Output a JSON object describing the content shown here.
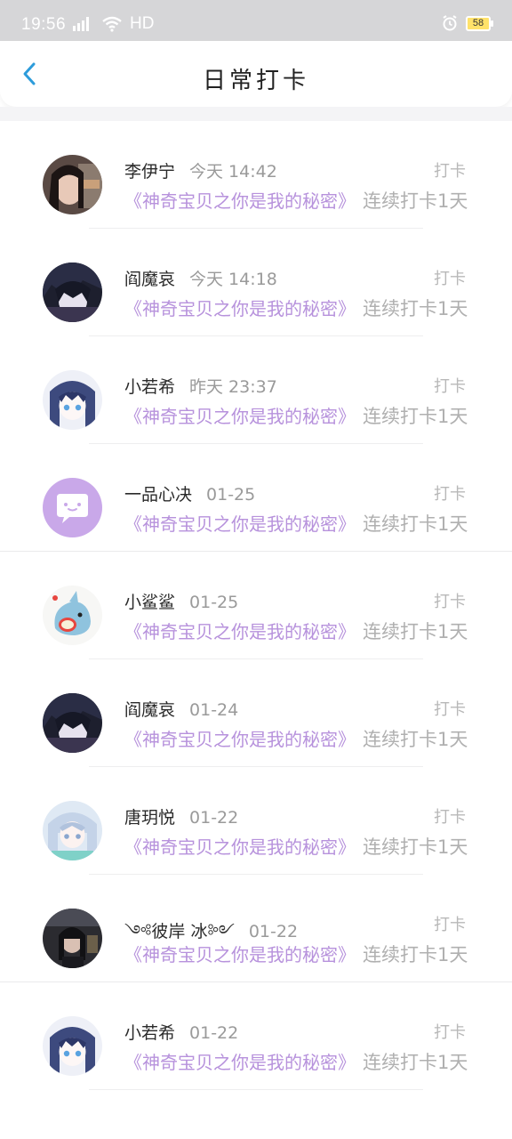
{
  "status_bar": {
    "time": "19:56",
    "network": "4G",
    "hd": "HD",
    "battery": "58"
  },
  "nav": {
    "title": "日常打卡"
  },
  "colors": {
    "accent": "#2d9cdb",
    "book_title": "#b792dc",
    "muted": "#b0b0b0"
  },
  "entries": [
    {
      "name": "李伊宁",
      "time": "今天 14:42",
      "label": "打卡",
      "book": "《神奇宝贝之你是我的秘密》",
      "streak": "连续打卡1天",
      "avatar": "photo-girl"
    },
    {
      "name": "阎魔哀",
      "time": "今天 14:18",
      "label": "打卡",
      "book": "《神奇宝贝之你是我的秘密》",
      "streak": "连续打卡1天",
      "avatar": "anime-dark"
    },
    {
      "name": "小若希",
      "time": "昨天 23:37",
      "label": "打卡",
      "book": "《神奇宝贝之你是我的秘密》",
      "streak": "连续打卡1天",
      "avatar": "anime-bluehair"
    },
    {
      "name": "一品心决",
      "time": "01-25",
      "label": "打卡",
      "book": "《神奇宝贝之你是我的秘密》",
      "streak": "连续打卡1天",
      "avatar": "default-purple"
    },
    {
      "name": "小鲨鲨",
      "time": "01-25",
      "label": "打卡",
      "book": "《神奇宝贝之你是我的秘密》",
      "streak": "连续打卡1天",
      "avatar": "shark"
    },
    {
      "name": "阎魔哀",
      "time": "01-24",
      "label": "打卡",
      "book": "《神奇宝贝之你是我的秘密》",
      "streak": "连续打卡1天",
      "avatar": "anime-dark"
    },
    {
      "name": "唐玥悦",
      "time": "01-22",
      "label": "打卡",
      "book": "《神奇宝贝之你是我的秘密》",
      "streak": "连续打卡1天",
      "avatar": "anime-silver"
    },
    {
      "name": "༺彼岸 冰༻",
      "time": "01-22",
      "label": "打卡",
      "book": "《神奇宝贝之你是我的秘密》",
      "streak": "连续打卡1天",
      "avatar": "photo-dark"
    },
    {
      "name": "小若希",
      "time": "01-22",
      "label": "打卡",
      "book": "《神奇宝贝之你是我的秘密》",
      "streak": "连续打卡1天",
      "avatar": "anime-bluehair"
    }
  ]
}
